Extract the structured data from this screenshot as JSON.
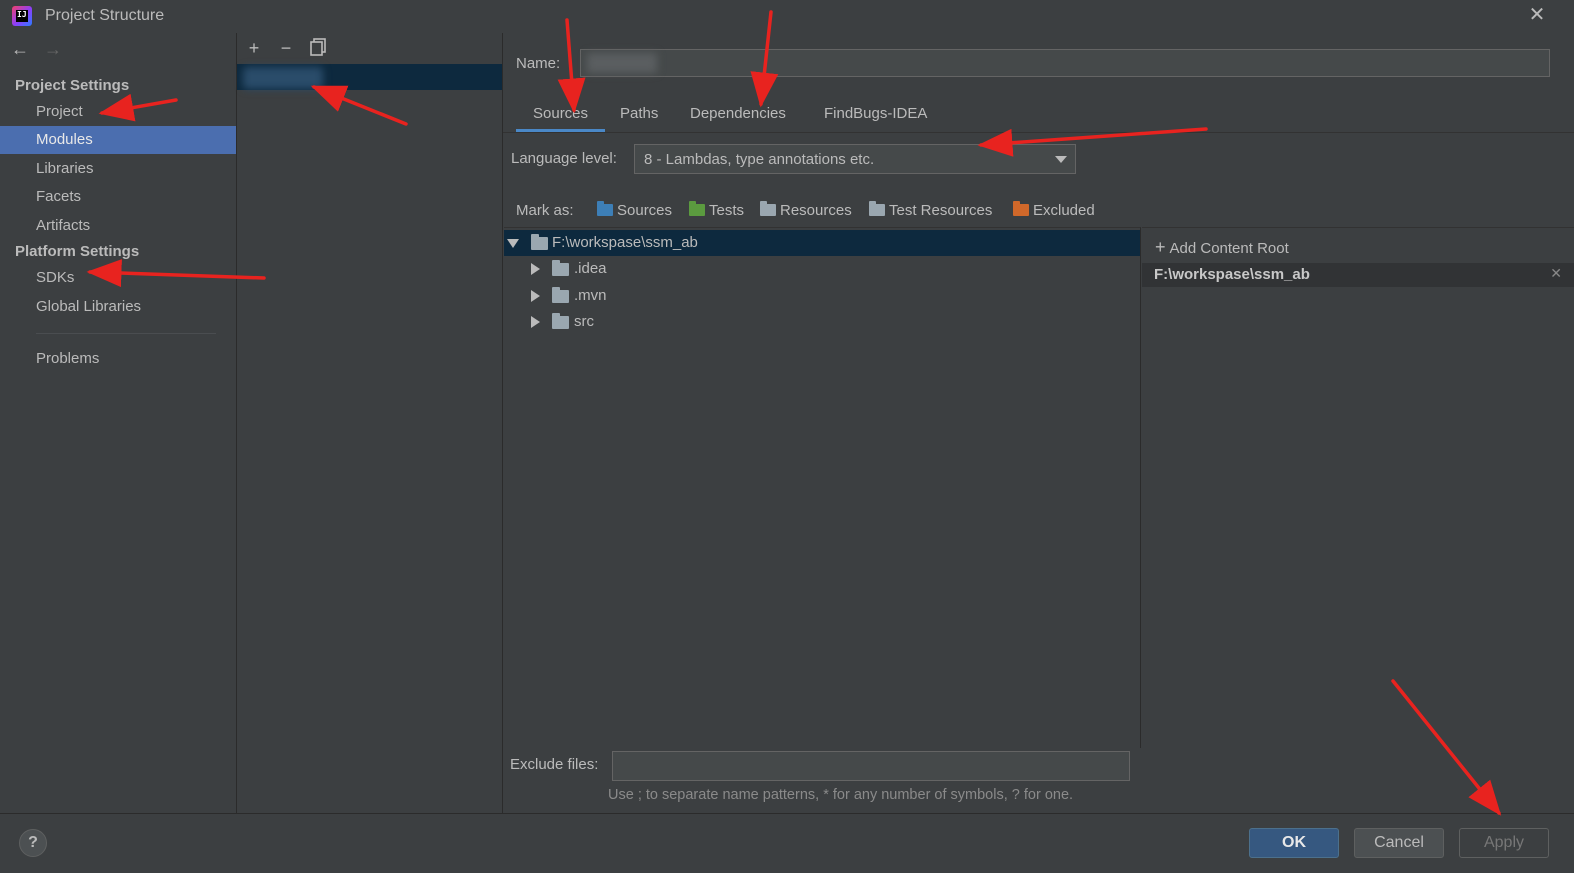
{
  "window": {
    "title": "Project Structure"
  },
  "leftnav": {
    "project_settings_header": "Project Settings",
    "platform_settings_header": "Platform Settings",
    "items": [
      {
        "label": "Project"
      },
      {
        "label": "Modules"
      },
      {
        "label": "Libraries"
      },
      {
        "label": "Facets"
      },
      {
        "label": "Artifacts"
      },
      {
        "label": "SDKs"
      },
      {
        "label": "Global Libraries"
      },
      {
        "label": "Problems"
      }
    ]
  },
  "toolbar": {
    "add": "+",
    "remove": "−"
  },
  "module": {
    "name_label": "Name:",
    "tabs": [
      {
        "label": "Sources"
      },
      {
        "label": "Paths"
      },
      {
        "label": "Dependencies"
      },
      {
        "label": "FindBugs-IDEA"
      }
    ],
    "language_level_label": "Language level:",
    "language_level_value": "8 - Lambdas, type annotations etc.",
    "mark_as_label": "Mark as:",
    "mark_as": [
      {
        "label": "Sources",
        "color": "#3d7fb7"
      },
      {
        "label": "Tests",
        "color": "#5b9b3f"
      },
      {
        "label": "Resources",
        "color": "#9aa7b0"
      },
      {
        "label": "Test Resources",
        "color": "#9aa7b0"
      },
      {
        "label": "Excluded",
        "color": "#d0682a"
      }
    ],
    "tree": [
      {
        "label": "F:\\workspase\\ssm_ab"
      },
      {
        "label": ".idea"
      },
      {
        "label": ".mvn"
      },
      {
        "label": "src"
      }
    ],
    "add_content_root": "Add Content Root",
    "content_root_path": "F:\\workspase\\ssm_ab",
    "exclude_files_label": "Exclude files:",
    "exclude_hint": "Use ; to separate name patterns, * for any number of symbols, ? for one."
  },
  "buttons": {
    "help": "?",
    "ok": "OK",
    "cancel": "Cancel",
    "apply": "Apply"
  },
  "colors": {
    "selection": "#4b6eaf",
    "annotation_arrow": "#e8231f",
    "primary_button": "#365880"
  }
}
